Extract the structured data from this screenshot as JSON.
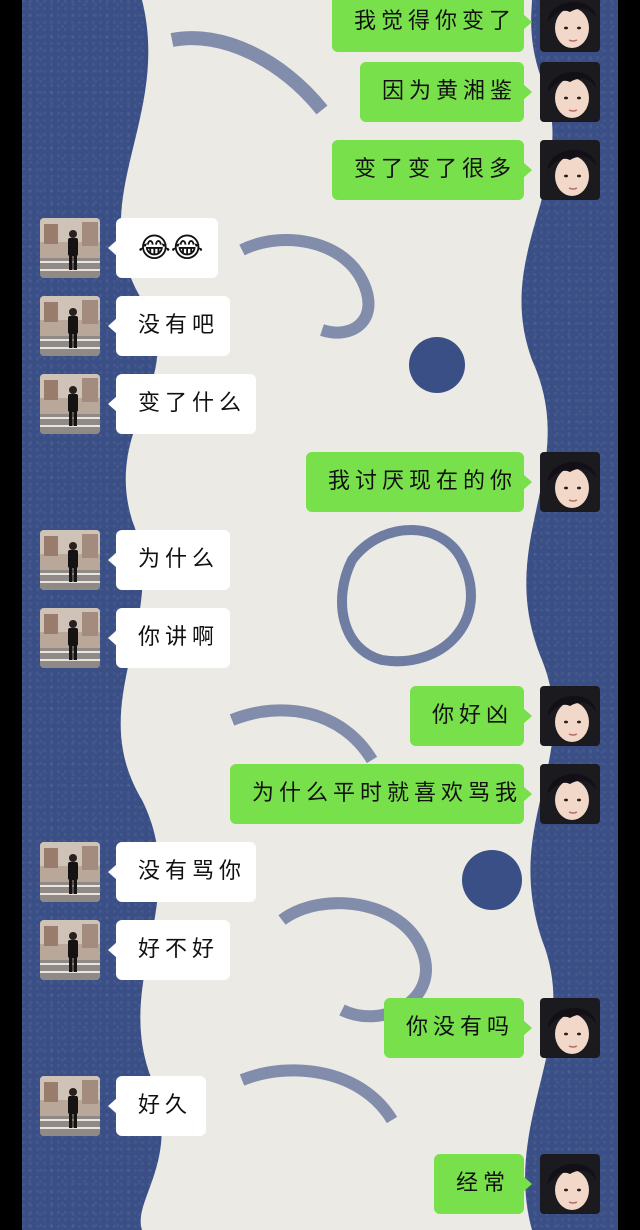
{
  "chat": {
    "messages": [
      {
        "side": "right",
        "text": "我觉得你变了"
      },
      {
        "side": "right",
        "text": "因为黄湘鉴"
      },
      {
        "side": "right",
        "text": "变了变了很多"
      },
      {
        "side": "left",
        "text": "😂😂"
      },
      {
        "side": "left",
        "text": "没有吧"
      },
      {
        "side": "left",
        "text": "变了什么"
      },
      {
        "side": "right",
        "text": "我讨厌现在的你"
      },
      {
        "side": "left",
        "text": "为什么"
      },
      {
        "side": "left",
        "text": "你讲啊"
      },
      {
        "side": "right",
        "text": "你好凶"
      },
      {
        "side": "right",
        "text": "为什么平时就喜欢骂我"
      },
      {
        "side": "left",
        "text": "没有骂你"
      },
      {
        "side": "left",
        "text": "好不好"
      },
      {
        "side": "right",
        "text": "你没有吗"
      },
      {
        "side": "left",
        "text": "好久"
      },
      {
        "side": "right",
        "text": "经常"
      }
    ]
  },
  "colors": {
    "sent_bubble": "#78e04a",
    "received_bubble": "#ffffff",
    "wallpaper": "#3a4f86"
  },
  "icons": {
    "right_avatar": "boy-portrait-avatar",
    "left_avatar": "street-photo-avatar"
  }
}
